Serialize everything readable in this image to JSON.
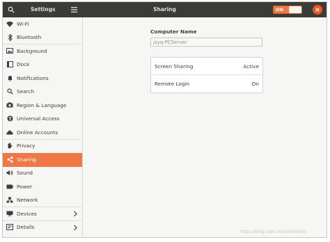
{
  "titlebar": {
    "app_title": "Settings",
    "panel_title": "Sharing",
    "toggle_label": "ON"
  },
  "sidebar": {
    "items": [
      {
        "label": "Wi-Fi",
        "icon": "wifi-icon"
      },
      {
        "label": "Bluetooth",
        "icon": "bluetooth-icon"
      },
      {
        "label": "Background",
        "icon": "background-icon"
      },
      {
        "label": "Dock",
        "icon": "dock-icon"
      },
      {
        "label": "Notifications",
        "icon": "bell-icon"
      },
      {
        "label": "Search",
        "icon": "search-icon"
      },
      {
        "label": "Region & Language",
        "icon": "camera-icon"
      },
      {
        "label": "Universal Access",
        "icon": "accessibility-icon"
      },
      {
        "label": "Online Accounts",
        "icon": "cloud-icon"
      },
      {
        "label": "Privacy",
        "icon": "hand-icon"
      },
      {
        "label": "Sharing",
        "icon": "share-icon"
      },
      {
        "label": "Sound",
        "icon": "speaker-icon"
      },
      {
        "label": "Power",
        "icon": "battery-icon"
      },
      {
        "label": "Network",
        "icon": "network-icon"
      },
      {
        "label": "Devices",
        "icon": "devices-icon"
      },
      {
        "label": "Details",
        "icon": "details-icon"
      }
    ]
  },
  "content": {
    "computer_name_label": "Computer Name",
    "computer_name_value": "jzyq-PCServer",
    "rows": [
      {
        "name": "Screen Sharing",
        "status": "Active"
      },
      {
        "name": "Remote Login",
        "status": "On"
      }
    ]
  },
  "colors": {
    "accent": "#f07746",
    "titlebar": "#3b3b37",
    "close": "#e9562a"
  },
  "watermark": "https://blog.csdn.net/u0005000"
}
